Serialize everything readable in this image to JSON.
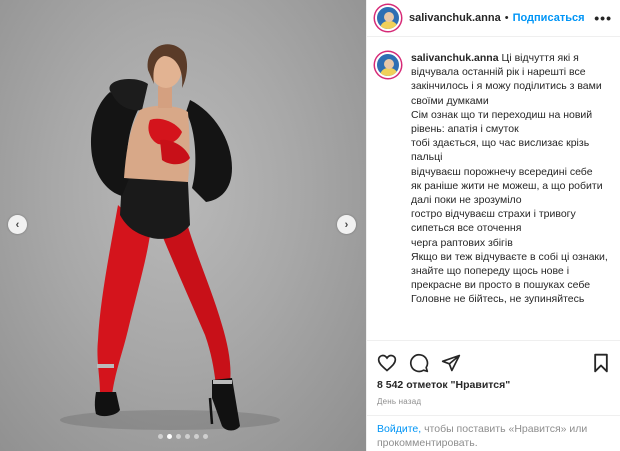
{
  "post": {
    "username": "salivanchuk.anna",
    "follow_label": "Подписаться",
    "header_separator": "•",
    "more_label": "•••",
    "caption_lines": [
      "Ці відчуття які я відчувала останній рік⁠⁠⁠ і нарешті все закінчилось і я можу поділитись з вами своїми думками⁠⁠",
      "Сім ознак що ти переходиш на новий рівень: ⁠апатія і смуток",
      "⁠тобі здається, що час вислизає крізь пальці",
      "⁠відчуваєш порожнечу всередині себе",
      "⁠як раніше жити не можеш, а що робити далі поки не зрозуміло",
      "⁠гостро відчуваєш страхи і тривогу",
      "⁠сипеться все оточення",
      "⁠черга раптових збігів",
      "Якщо ви теж відчуваєте в собі ці ознаки, знайте що попереду щось нове і прекрасне ви просто в пошуках себе⁠⁠",
      "Головне не бійтесь, не зупиняйтесь"
    ],
    "likes_text": "8 542 отметок \"Нравится\"",
    "time_text": "День назад",
    "login_link": "Войдите,",
    "login_rest": " чтобы поставить «Нравится» или прокомментировать."
  },
  "carousel": {
    "prev_icon": "chevron-left-icon",
    "next_icon": "chevron-right-icon",
    "dot_count": 6,
    "active_dot": 2
  },
  "icons": {
    "like": "heart-icon",
    "comment": "comment-icon",
    "share": "share-icon",
    "save": "bookmark-icon"
  },
  "colors": {
    "link": "#0095f6",
    "text": "#262626",
    "muted": "#8e8e8e",
    "tights": "#d4141c"
  }
}
